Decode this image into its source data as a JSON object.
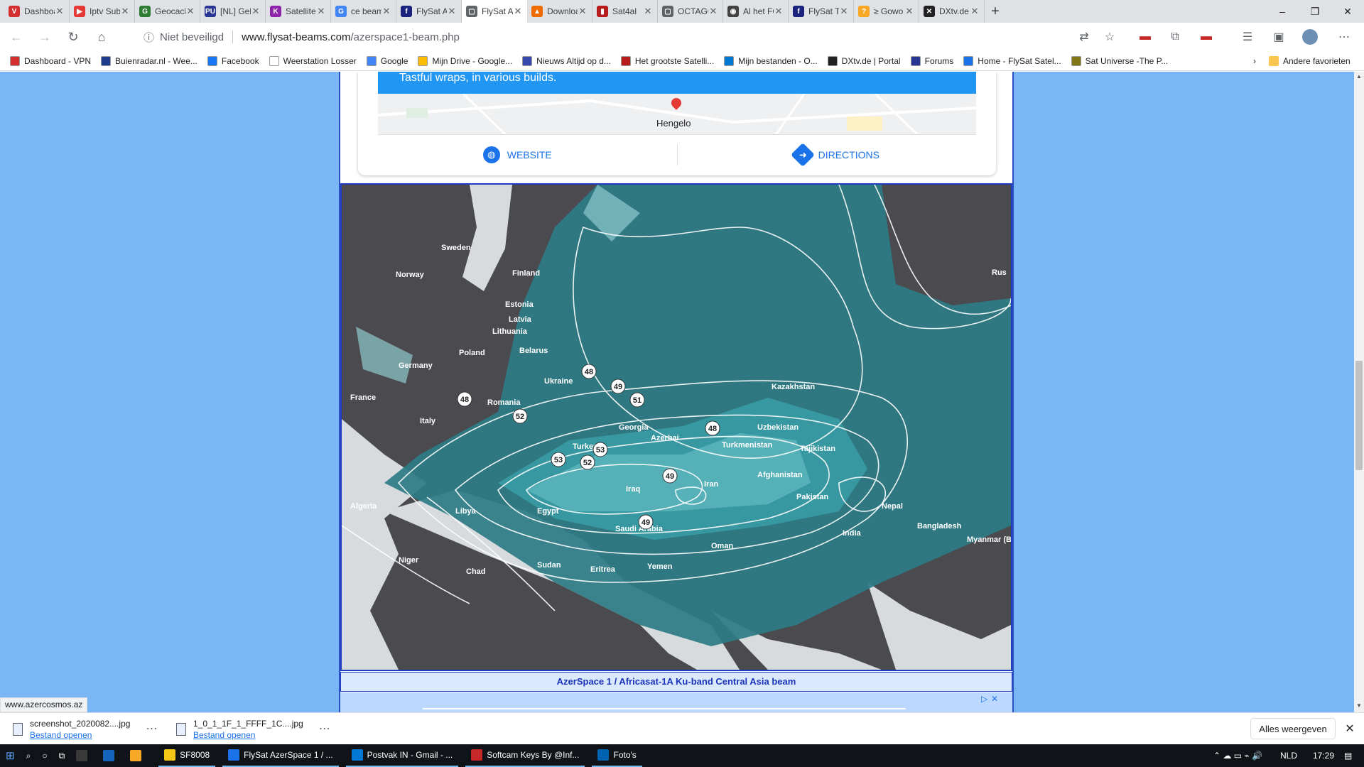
{
  "tabs": [
    {
      "title": "Dashboa",
      "color": "#d32f2f",
      "glyph": "V"
    },
    {
      "title": "Iptv Subs",
      "color": "#e53935",
      "glyph": "▶"
    },
    {
      "title": "Geocach",
      "color": "#2e7d32",
      "glyph": "G"
    },
    {
      "title": "[NL] Geb",
      "color": "#283593",
      "glyph": "PU"
    },
    {
      "title": "Satellites",
      "color": "#8e24aa",
      "glyph": "K"
    },
    {
      "title": "ce beam",
      "color": "#4285f4",
      "glyph": "G"
    },
    {
      "title": "FlySat Az",
      "color": "#1a237e",
      "glyph": "f"
    },
    {
      "title": "FlySat Az",
      "color": "#5f6368",
      "glyph": "▢",
      "active": true
    },
    {
      "title": "Downloa",
      "color": "#ef6c00",
      "glyph": "▲"
    },
    {
      "title": "Sat4al",
      "color": "#b71c1c",
      "glyph": "▮"
    },
    {
      "title": "OCTAGO",
      "color": "#5f6368",
      "glyph": "▢"
    },
    {
      "title": "Al het FC",
      "color": "#424242",
      "glyph": "◉"
    },
    {
      "title": "FlySat Tu",
      "color": "#1a237e",
      "glyph": "f"
    },
    {
      "title": "≥ Gowo",
      "color": "#f9a825",
      "glyph": "?"
    },
    {
      "title": "DXtv.de",
      "color": "#212121",
      "glyph": "✕"
    }
  ],
  "toolbar": {
    "security_label": "Niet beveiligd",
    "url_host": "www.flysat-beams.com",
    "url_path": "/azerspace1-beam.php"
  },
  "bookmarks": [
    {
      "label": "Dashboard - VPN",
      "color": "#d32f2f"
    },
    {
      "label": "Buienradar.nl - Wee...",
      "color": "#1e3a8a"
    },
    {
      "label": "Facebook",
      "color": "#1877f2"
    },
    {
      "label": "Weerstation Losser",
      "color": "#ffffff"
    },
    {
      "label": "Google",
      "color": "#4285f4"
    },
    {
      "label": "Mijn Drive - Google...",
      "color": "#fbbc04"
    },
    {
      "label": "Nieuws  Altijd op d...",
      "color": "#3949ab"
    },
    {
      "label": "Het grootste Satelli...",
      "color": "#b71c1c"
    },
    {
      "label": "Mijn bestanden - O...",
      "color": "#0078d4"
    },
    {
      "label": "DXtv.de | Portal",
      "color": "#212121"
    },
    {
      "label": "Forums",
      "color": "#283593"
    },
    {
      "label": "Home - FlySat Satel...",
      "color": "#1a73e8"
    },
    {
      "label": "Sat Universe -The P...",
      "color": "#827717"
    }
  ],
  "bookmarks_other": "Andere favorieten",
  "card": {
    "banner_text": "Tastful wraps, in various builds.",
    "map_place": "Hengelo",
    "website_label": "WEBSITE",
    "directions_label": "DIRECTIONS"
  },
  "map": {
    "countries": [
      {
        "name": "Sweden"
      },
      {
        "name": "Norway"
      },
      {
        "name": "Finland"
      },
      {
        "name": "Estonia"
      },
      {
        "name": "Latvia"
      },
      {
        "name": "Lithuania"
      },
      {
        "name": "Poland"
      },
      {
        "name": "Belarus"
      },
      {
        "name": "Germany"
      },
      {
        "name": "France"
      },
      {
        "name": "Italy"
      },
      {
        "name": "Ukraine"
      },
      {
        "name": "Romania"
      },
      {
        "name": "Turkey"
      },
      {
        "name": "Georgia"
      },
      {
        "name": "Azerbai"
      },
      {
        "name": "Kazakhstan"
      },
      {
        "name": "Uzbekistan"
      },
      {
        "name": "Turkmenistan"
      },
      {
        "name": "Tajikistan"
      },
      {
        "name": "Afghanistan"
      },
      {
        "name": "Iran"
      },
      {
        "name": "Iraq"
      },
      {
        "name": "Pakistan"
      },
      {
        "name": "India"
      },
      {
        "name": "Nepal"
      },
      {
        "name": "Bangladesh"
      },
      {
        "name": "Myanmar (Burma)"
      },
      {
        "name": "Algeria"
      },
      {
        "name": "Libya"
      },
      {
        "name": "Egypt"
      },
      {
        "name": "Saudi Arabia"
      },
      {
        "name": "Niger"
      },
      {
        "name": "Chad"
      },
      {
        "name": "Sudan"
      },
      {
        "name": "Yemen"
      },
      {
        "name": "Eritrea"
      },
      {
        "name": "Oman"
      },
      {
        "name": "Rus"
      }
    ],
    "contour_labels": [
      "48",
      "49",
      "51",
      "48",
      "52",
      "48",
      "53",
      "53",
      "52",
      "49",
      "49"
    ]
  },
  "caption": "AzerSpace 1 / Africasat-1A Ku-band Central Asia beam",
  "status_url": "www.azercosmos.az",
  "downloads": [
    {
      "name": "screenshot_2020082....jpg",
      "open": "Bestand openen"
    },
    {
      "name": "1_0_1_1F_1_FFFF_1C....jpg",
      "open": "Bestand openen"
    }
  ],
  "downloads_show_all": "Alles weergeven",
  "taskbar": {
    "apps": [
      {
        "label": "SF8008",
        "color": "#f5c518"
      },
      {
        "label": "FlySat AzerSpace 1 / ...",
        "color": "#1a73e8"
      },
      {
        "label": "Postvak IN - Gmail - ...",
        "color": "#0078d4"
      },
      {
        "label": "Softcam Keys By @Inf...",
        "color": "#c62828"
      },
      {
        "label": "Foto's",
        "color": "#0063b1"
      }
    ],
    "lang": "NLD",
    "time": "17:29"
  }
}
